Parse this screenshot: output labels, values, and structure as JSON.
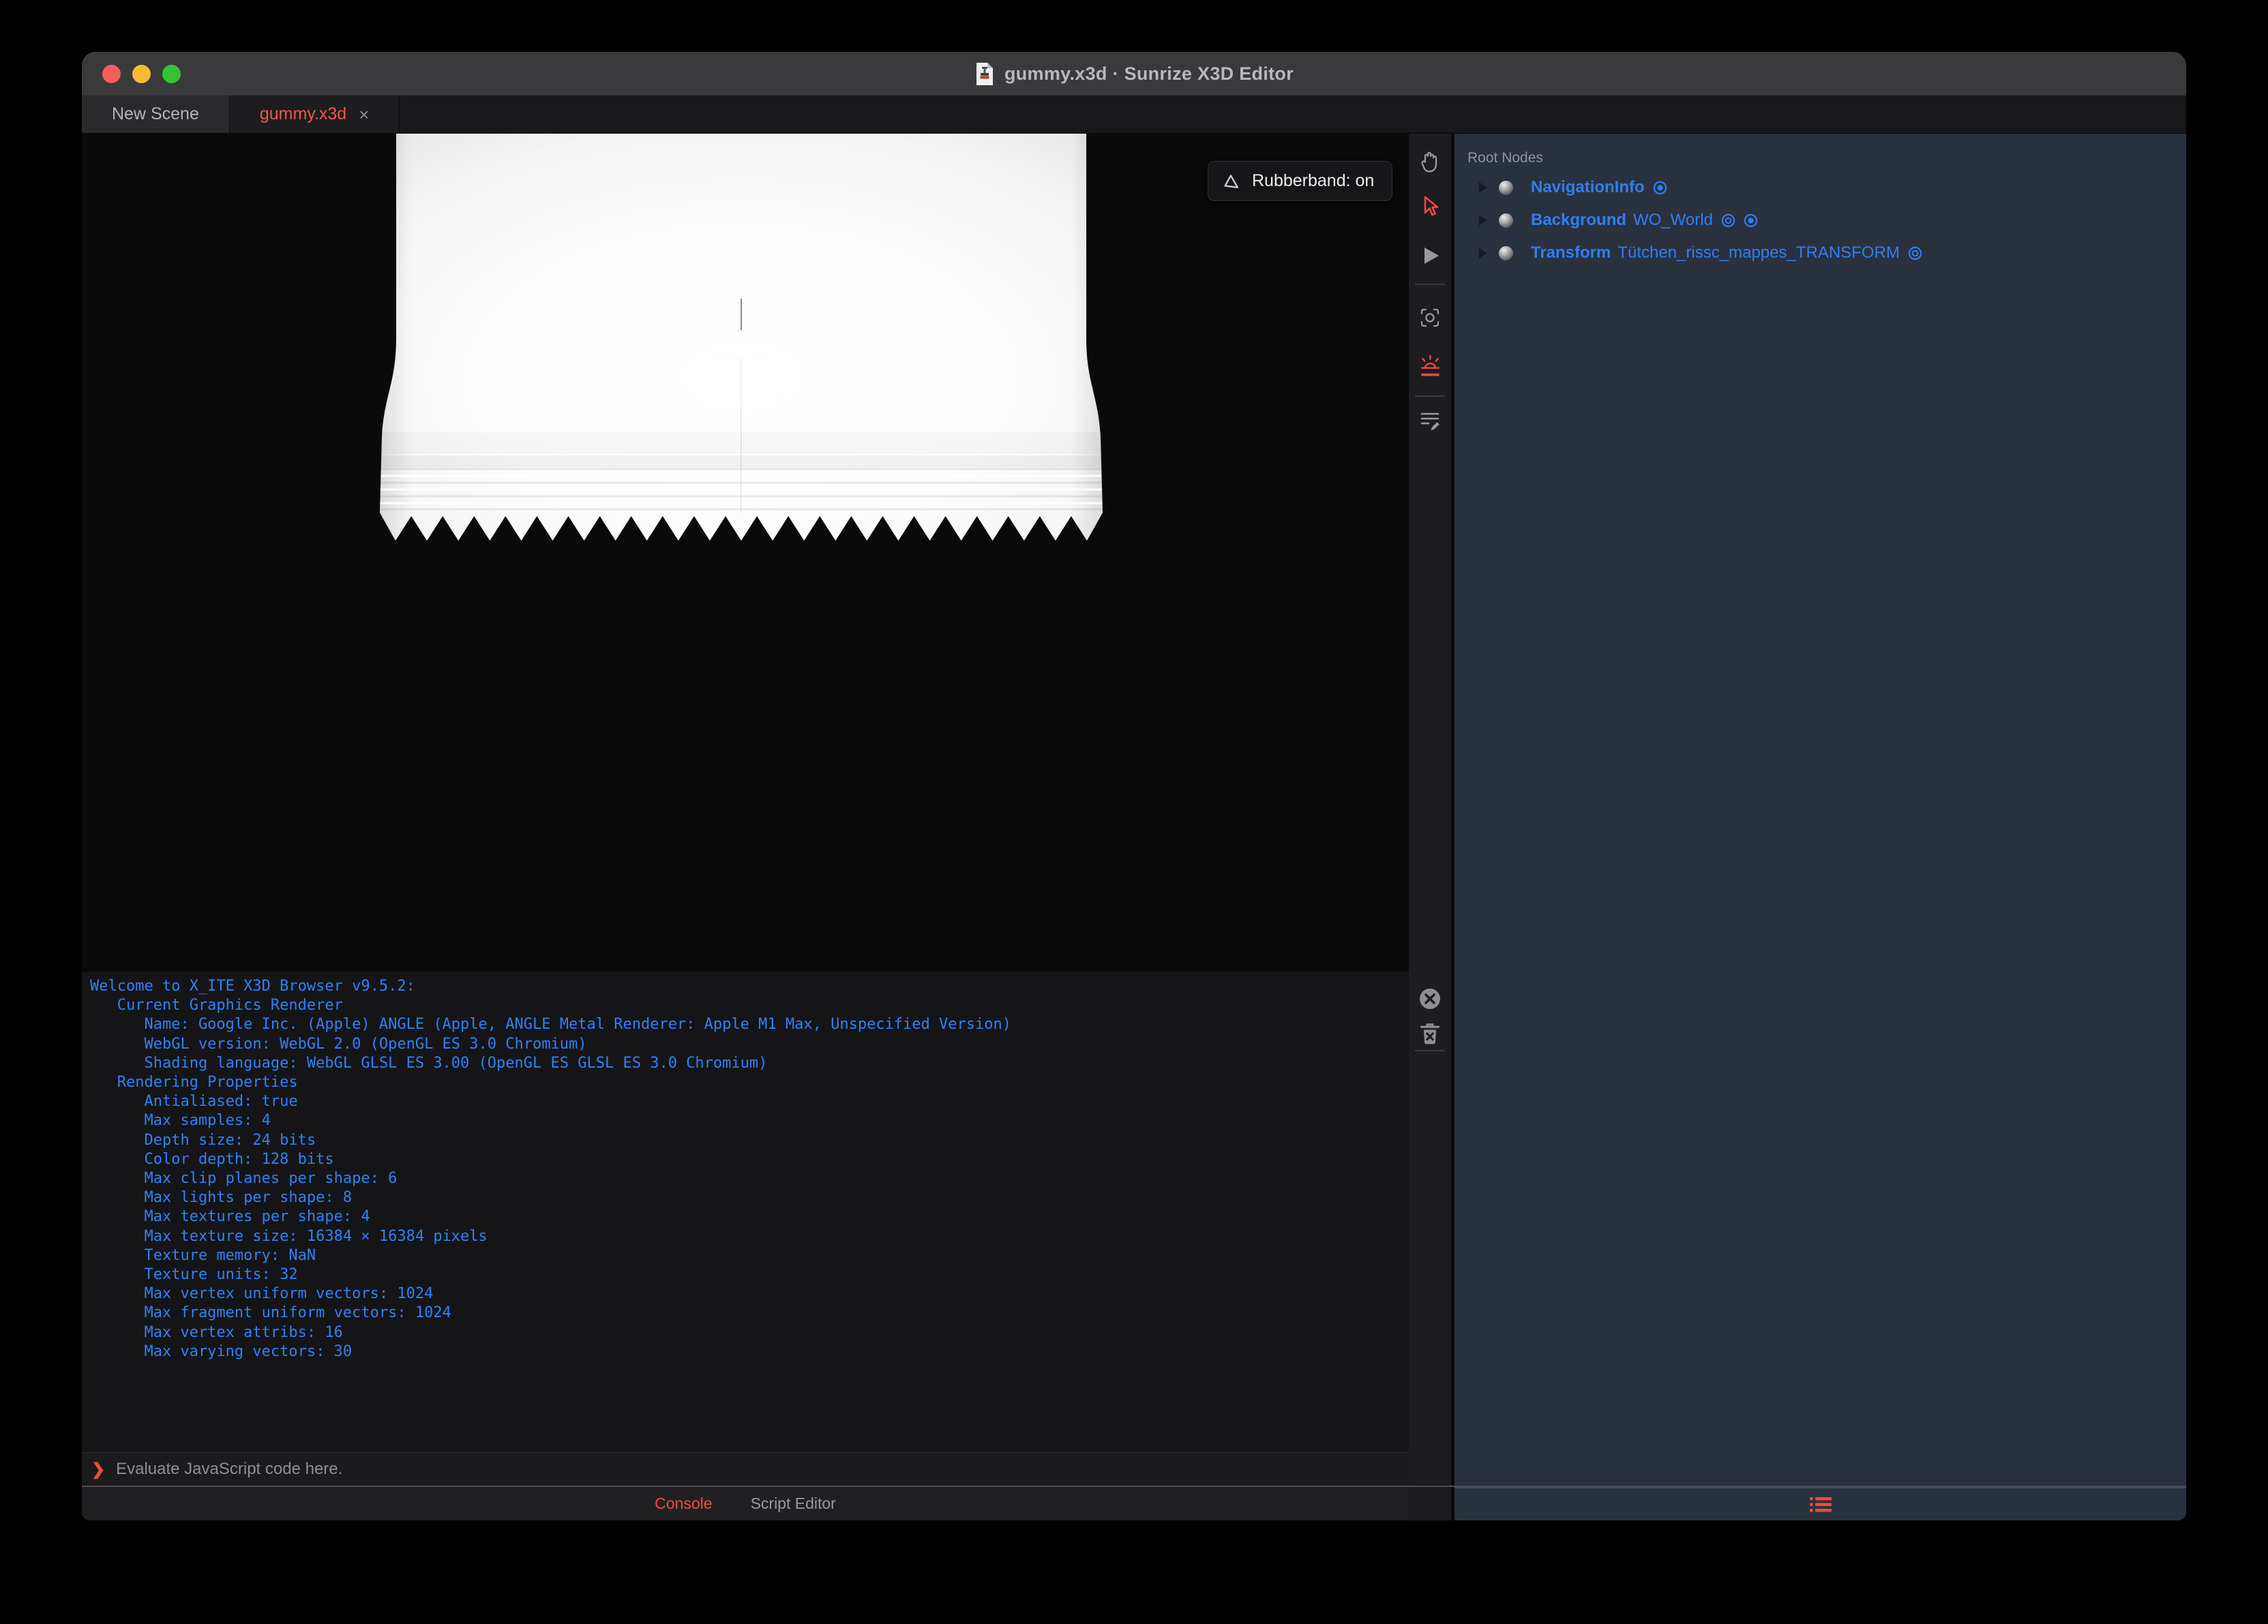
{
  "window": {
    "title": "gummy.x3d · Sunrize X3D Editor"
  },
  "tab_bar": {
    "tabs": [
      {
        "label": "New Scene",
        "active": false
      },
      {
        "label": "gummy.x3d",
        "active": true
      }
    ],
    "close_label": "×"
  },
  "viewport": {
    "rubberband_label": "Rubberband: on"
  },
  "outliner": {
    "header": "Root Nodes",
    "nodes": [
      {
        "type": "NavigationInfo",
        "name": "",
        "icons": [
          "bound"
        ]
      },
      {
        "type": "Background",
        "name": "WO_World",
        "icons": [
          "visibility",
          "bound"
        ]
      },
      {
        "type": "Transform",
        "name": "Tütchen_rissc_mappes_TRANSFORM",
        "icons": [
          "visibility"
        ]
      }
    ]
  },
  "console": {
    "lines": [
      "Welcome to X_ITE X3D Browser v9.5.2:",
      "   Current Graphics Renderer",
      "      Name: Google Inc. (Apple) ANGLE (Apple, ANGLE Metal Renderer: Apple M1 Max, Unspecified Version)",
      "      WebGL version: WebGL 2.0 (OpenGL ES 3.0 Chromium)",
      "      Shading language: WebGL GLSL ES 3.00 (OpenGL ES GLSL ES 3.0 Chromium)",
      "   Rendering Properties",
      "      Antialiased: true",
      "      Max samples: 4",
      "      Depth size: 24 bits",
      "      Color depth: 128 bits",
      "      Max clip planes per shape: 6",
      "      Max lights per shape: 8",
      "      Max textures per shape: 4",
      "      Max texture size: 16384 × 16384 pixels",
      "      Texture memory: NaN",
      "      Texture units: 32",
      "      Max vertex uniform vectors: 1024",
      "      Max fragment uniform vectors: 1024",
      "      Max vertex attribs: 16",
      "      Max varying vectors: 30"
    ],
    "prompt_symbol": "❯",
    "prompt_placeholder": "Evaluate JavaScript code here."
  },
  "footer": {
    "tabs": [
      {
        "label": "Console",
        "active": true
      },
      {
        "label": "Script Editor",
        "active": false
      }
    ]
  },
  "colors": {
    "accent_red": "#f4493c",
    "tree_blue": "#2e7ef7",
    "console_blue": "#2f81f7",
    "panel_bg": "#2a313e"
  }
}
